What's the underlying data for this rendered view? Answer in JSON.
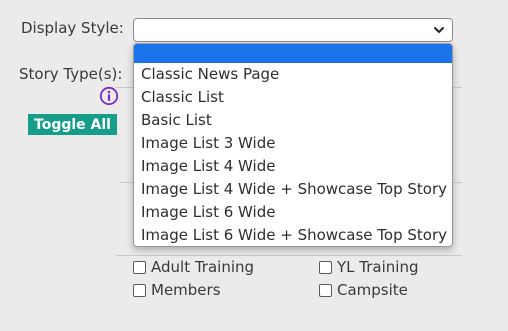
{
  "display_style": {
    "label": "Display Style:",
    "value": ""
  },
  "story_types": {
    "label": "Story Type(s):"
  },
  "toggle_all": {
    "label": "Toggle All"
  },
  "checkboxes": [
    {
      "label": "Adult Training",
      "checked": false
    },
    {
      "label": "YL Training",
      "checked": false
    },
    {
      "label": "Members",
      "checked": false
    },
    {
      "label": "Campsite",
      "checked": false
    }
  ],
  "dropdown": {
    "options": [
      "",
      "Classic News Page",
      "Classic List",
      "Basic List",
      "Image List 3 Wide",
      "Image List 4 Wide",
      "Image List 4 Wide + Showcase Top Story",
      "Image List 6 Wide",
      "Image List 6 Wide + Showcase Top Story"
    ],
    "selected_index": 0
  },
  "colors": {
    "accent": "#179e8a",
    "highlight": "#1a73e8",
    "info_icon": "#7b2cc9",
    "background": "#ebebeb"
  },
  "icons": {
    "info": "info-icon",
    "chevron": "chevron-down-icon"
  }
}
